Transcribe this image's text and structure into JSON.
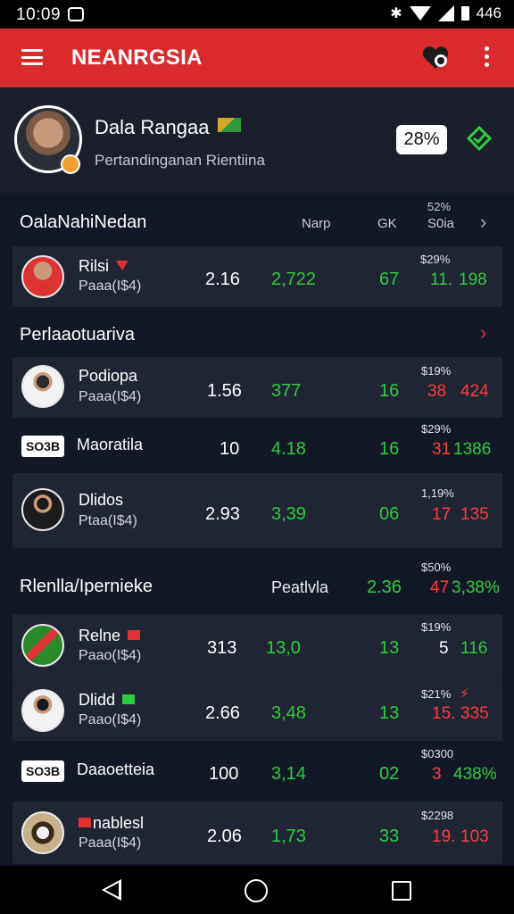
{
  "status_bar": {
    "time": "10:09",
    "battery_text": "446",
    "bluetooth_glyph": "✱"
  },
  "app_bar": {
    "title": "NEANRGSIA",
    "icons": [
      "menu-icon",
      "favorites-icon",
      "more-vert-icon"
    ]
  },
  "profile": {
    "name": "Dala Rangaa",
    "subtitle": "Pertandinganan Rientiina",
    "percent": "28%"
  },
  "section1": {
    "title": "OalaNahiNedan",
    "columns": [
      "Narp",
      "GK",
      "S0ia"
    ],
    "col_top": "52%",
    "rows": [
      {
        "type": "avatar",
        "name": "Rilsi",
        "sub": "Paaa(I$4)",
        "v1": "2.16",
        "v2": "2,722",
        "v3": "67",
        "small": "$29%",
        "a": "11.",
        "b": "198",
        "a_color": "green",
        "b_color": "green"
      }
    ]
  },
  "section2": {
    "title": "Perlaaotuariva",
    "rows": [
      {
        "type": "avatar",
        "name": "Podiopa",
        "sub": "Paaa(I$4)",
        "v1": "1.56",
        "v2": "377",
        "v3": "16",
        "small": "$19%",
        "a": "38",
        "b": "424",
        "a_color": "red",
        "b_color": "red"
      },
      {
        "type": "tag",
        "tag": "SO3B",
        "name": "Maoratila",
        "v1": "10",
        "v2": "4.18",
        "v3": "16",
        "small": "$29%",
        "a": "31",
        "b": "1386",
        "a_color": "red",
        "b_color": "green"
      },
      {
        "type": "avatar",
        "name": "Dlidos",
        "sub": "Ptaa(I$4)",
        "v1": "2.93",
        "v2": "3,39",
        "v3": "06",
        "small": "1,19%",
        "a": "17",
        "b": "135",
        "a_color": "red",
        "b_color": "red"
      }
    ]
  },
  "section3": {
    "title": "Rlenlla/Ipernieke",
    "col_label": "Peatlvla",
    "col_value": "2.36",
    "col_small": "$50%",
    "col_a": "47",
    "col_b": "3,38%",
    "rows": [
      {
        "type": "avatar",
        "name": "Relne",
        "sub": "Paao(I$4)",
        "v1": "313",
        "v2": "13,0",
        "v3": "13",
        "small": "$19%",
        "a": "5",
        "b": "116",
        "a_color": "white",
        "b_color": "green"
      },
      {
        "type": "avatar",
        "name": "Dlidd",
        "sub": "Paao(I$4)",
        "v1": "2.66",
        "v2": "3,48",
        "v3": "13",
        "small": "$21%",
        "a": "15.",
        "b": "335",
        "a_color": "red",
        "b_color": "red"
      },
      {
        "type": "tag",
        "tag": "SO3B",
        "name": "Daaoetteia",
        "v1": "100",
        "v2": "3,14",
        "v3": "02",
        "small": "$0300",
        "a": "3",
        "b": "438%",
        "a_color": "red",
        "b_color": "green"
      },
      {
        "type": "avatar",
        "name": "nablesl",
        "sub": "Paaa(I$4)",
        "v1": "2.06",
        "v2": "1,73",
        "v3": "33",
        "small": "$2298",
        "a": "19.",
        "b": "103",
        "a_color": "red",
        "b_color": "red"
      }
    ]
  },
  "colors": {
    "accent": "#d92b2b",
    "positive": "#2ecc40",
    "negative": "#ff3b3b",
    "background": "#101521"
  }
}
